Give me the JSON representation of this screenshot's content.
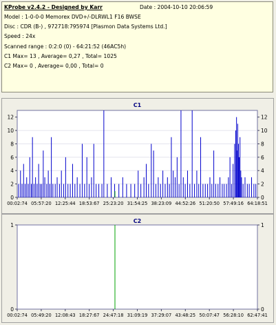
{
  "info": {
    "title": "KProbe v2.4.2 - Designed by Karr",
    "date": "Date : 2004-10-10 20:06:59",
    "model": "Model : 1-0-0-0 Memorex DVD+/-DLRWL1 F16 BWSE",
    "disc": "Disc : CDR (B-) , 972718:795974 [Plasmon Data Systems Ltd.]",
    "speed": "Speed : 24x",
    "range": "Scanned range : 0:2:0 (0) - 64:21:52 (46AC5h)",
    "c1_stats": "C1 Max= 13 , Average= 0,27 , Total= 1025",
    "c2_stats": "C2 Max= 0 , Average= 0,00 , Total= 0"
  },
  "chart_data": [
    {
      "type": "bar",
      "title": "C1",
      "ylim": [
        0,
        13
      ],
      "yticks": [
        "0",
        "2",
        "4",
        "6",
        "8",
        "10",
        "12"
      ],
      "xlim_minutes": [
        2.0457,
        64.3144
      ],
      "xticks": [
        "00:02:74",
        "05:57:20",
        "12:25:44",
        "18:53:67",
        "25:23:20",
        "31:54:25",
        "38:23:09",
        "44:52:26",
        "51:20:50",
        "57:49:16",
        "64:18:51"
      ],
      "bar_color": "#0000cc",
      "speed_line_color": "#00a000",
      "values": [
        [
          2.4,
          2
        ],
        [
          2.9,
          4
        ],
        [
          3.3,
          2
        ],
        [
          3.7,
          5
        ],
        [
          4.1,
          2
        ],
        [
          4.5,
          3
        ],
        [
          4.9,
          2
        ],
        [
          5.3,
          6
        ],
        [
          5.7,
          2
        ],
        [
          6.0,
          9
        ],
        [
          6.4,
          2
        ],
        [
          6.8,
          3
        ],
        [
          7.2,
          2
        ],
        [
          7.6,
          5
        ],
        [
          8.0,
          2
        ],
        [
          8.4,
          2
        ],
        [
          8.8,
          7
        ],
        [
          9.2,
          3
        ],
        [
          9.7,
          2
        ],
        [
          10.1,
          4
        ],
        [
          10.5,
          2
        ],
        [
          10.9,
          9
        ],
        [
          11.3,
          2
        ],
        [
          11.9,
          2
        ],
        [
          12.4,
          3
        ],
        [
          13.0,
          2
        ],
        [
          13.5,
          4
        ],
        [
          14.1,
          2
        ],
        [
          14.6,
          6
        ],
        [
          15.2,
          2
        ],
        [
          15.8,
          2
        ],
        [
          16.4,
          5
        ],
        [
          17.0,
          2
        ],
        [
          17.6,
          3
        ],
        [
          18.3,
          2
        ],
        [
          18.9,
          8
        ],
        [
          19.5,
          2
        ],
        [
          20.1,
          6
        ],
        [
          20.7,
          2
        ],
        [
          21.3,
          3
        ],
        [
          21.9,
          8
        ],
        [
          22.5,
          2
        ],
        [
          23.2,
          2
        ],
        [
          24.0,
          2
        ],
        [
          24.5,
          13
        ],
        [
          25.4,
          2
        ],
        [
          26.4,
          3
        ],
        [
          27.3,
          2
        ],
        [
          28.4,
          2
        ],
        [
          29.4,
          3
        ],
        [
          30.4,
          2
        ],
        [
          31.5,
          2
        ],
        [
          32.5,
          2
        ],
        [
          33.4,
          4
        ],
        [
          34.1,
          2
        ],
        [
          34.9,
          3
        ],
        [
          35.5,
          5
        ],
        [
          36.1,
          2
        ],
        [
          36.8,
          8
        ],
        [
          37.4,
          7
        ],
        [
          38.0,
          2
        ],
        [
          38.6,
          3
        ],
        [
          39.2,
          2
        ],
        [
          39.8,
          4
        ],
        [
          40.4,
          2
        ],
        [
          41.0,
          3
        ],
        [
          41.5,
          2
        ],
        [
          42.0,
          9
        ],
        [
          42.5,
          4
        ],
        [
          43.0,
          3
        ],
        [
          43.5,
          6
        ],
        [
          44.0,
          2
        ],
        [
          44.5,
          13
        ],
        [
          45.1,
          3
        ],
        [
          45.6,
          2
        ],
        [
          46.2,
          4
        ],
        [
          46.8,
          2
        ],
        [
          47.4,
          13
        ],
        [
          48.0,
          2
        ],
        [
          48.6,
          4
        ],
        [
          49.1,
          2
        ],
        [
          49.6,
          9
        ],
        [
          50.2,
          2
        ],
        [
          50.8,
          2
        ],
        [
          51.4,
          2
        ],
        [
          52.0,
          3
        ],
        [
          52.5,
          2
        ],
        [
          53.0,
          7
        ],
        [
          53.5,
          2
        ],
        [
          54.1,
          2
        ],
        [
          54.6,
          3
        ],
        [
          55.2,
          2
        ],
        [
          55.7,
          2
        ],
        [
          56.3,
          2
        ],
        [
          56.8,
          3
        ],
        [
          57.2,
          6
        ],
        [
          57.6,
          2
        ],
        [
          58.0,
          5
        ],
        [
          58.4,
          8
        ],
        [
          58.7,
          10
        ],
        [
          58.9,
          12
        ],
        [
          59.0,
          7
        ],
        [
          59.2,
          11
        ],
        [
          59.4,
          8
        ],
        [
          59.6,
          6
        ],
        [
          59.8,
          9
        ],
        [
          60.0,
          4
        ],
        [
          60.2,
          3
        ],
        [
          60.6,
          2
        ],
        [
          61.1,
          3
        ],
        [
          61.7,
          2
        ],
        [
          62.2,
          2
        ],
        [
          62.8,
          3
        ],
        [
          63.4,
          2
        ],
        [
          63.9,
          2
        ]
      ]
    },
    {
      "type": "bar",
      "title": "C2",
      "ylim": [
        0,
        1
      ],
      "yticks": [
        "0",
        "1"
      ],
      "xlim_minutes": [
        2.0457,
        64.3144
      ],
      "xticks": [
        "00:02:74",
        "05:49:20",
        "12:08:43",
        "18:27:67",
        "24:47:18",
        "31:09:19",
        "37:29:07",
        "43:48:25",
        "50:07:47",
        "56:28:10",
        "62:47:41"
      ],
      "values": [],
      "speed_line_color": "#00a000"
    }
  ]
}
